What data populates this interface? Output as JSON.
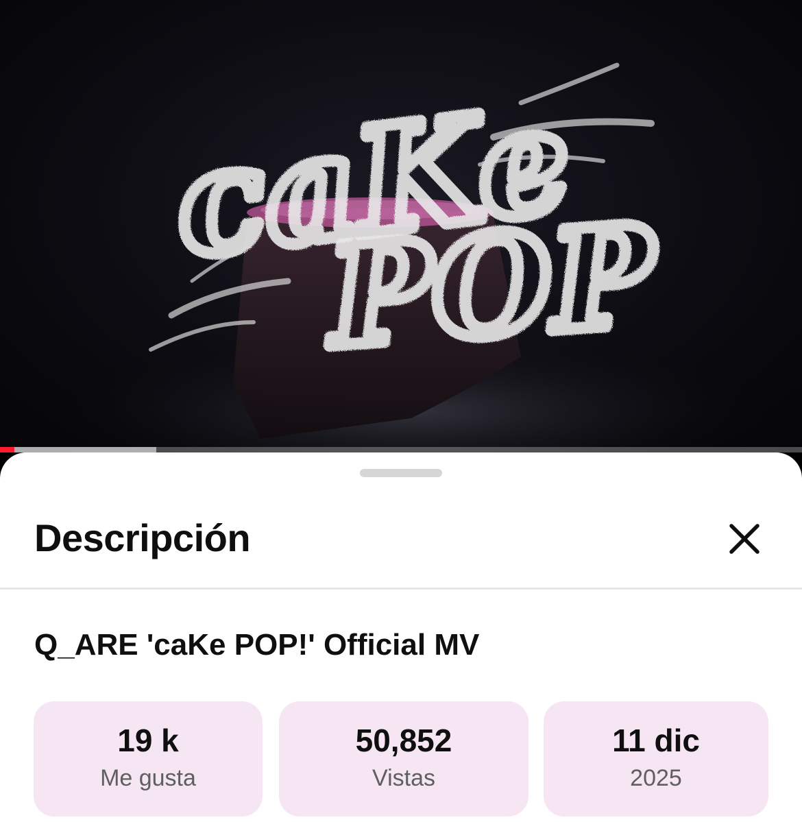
{
  "video": {
    "title_art_line1": "caKe",
    "title_art_line2": "POP",
    "progress": {
      "played_fraction": 0.018,
      "buffered_fraction": 0.195
    },
    "colors": {
      "progress_played": "#ff1b2d",
      "cake_pink": "#c0589a"
    }
  },
  "sheet": {
    "heading": "Descripción",
    "close_icon": "close-icon",
    "video_title": "Q_ARE 'caKe POP!' Official MV",
    "stats": [
      {
        "value": "19 k",
        "label": "Me gusta"
      },
      {
        "value": "50,852",
        "label": "Vistas"
      },
      {
        "value": "11 dic",
        "label": "2025"
      }
    ],
    "colors": {
      "stat_background": "#f6e6f3"
    }
  }
}
